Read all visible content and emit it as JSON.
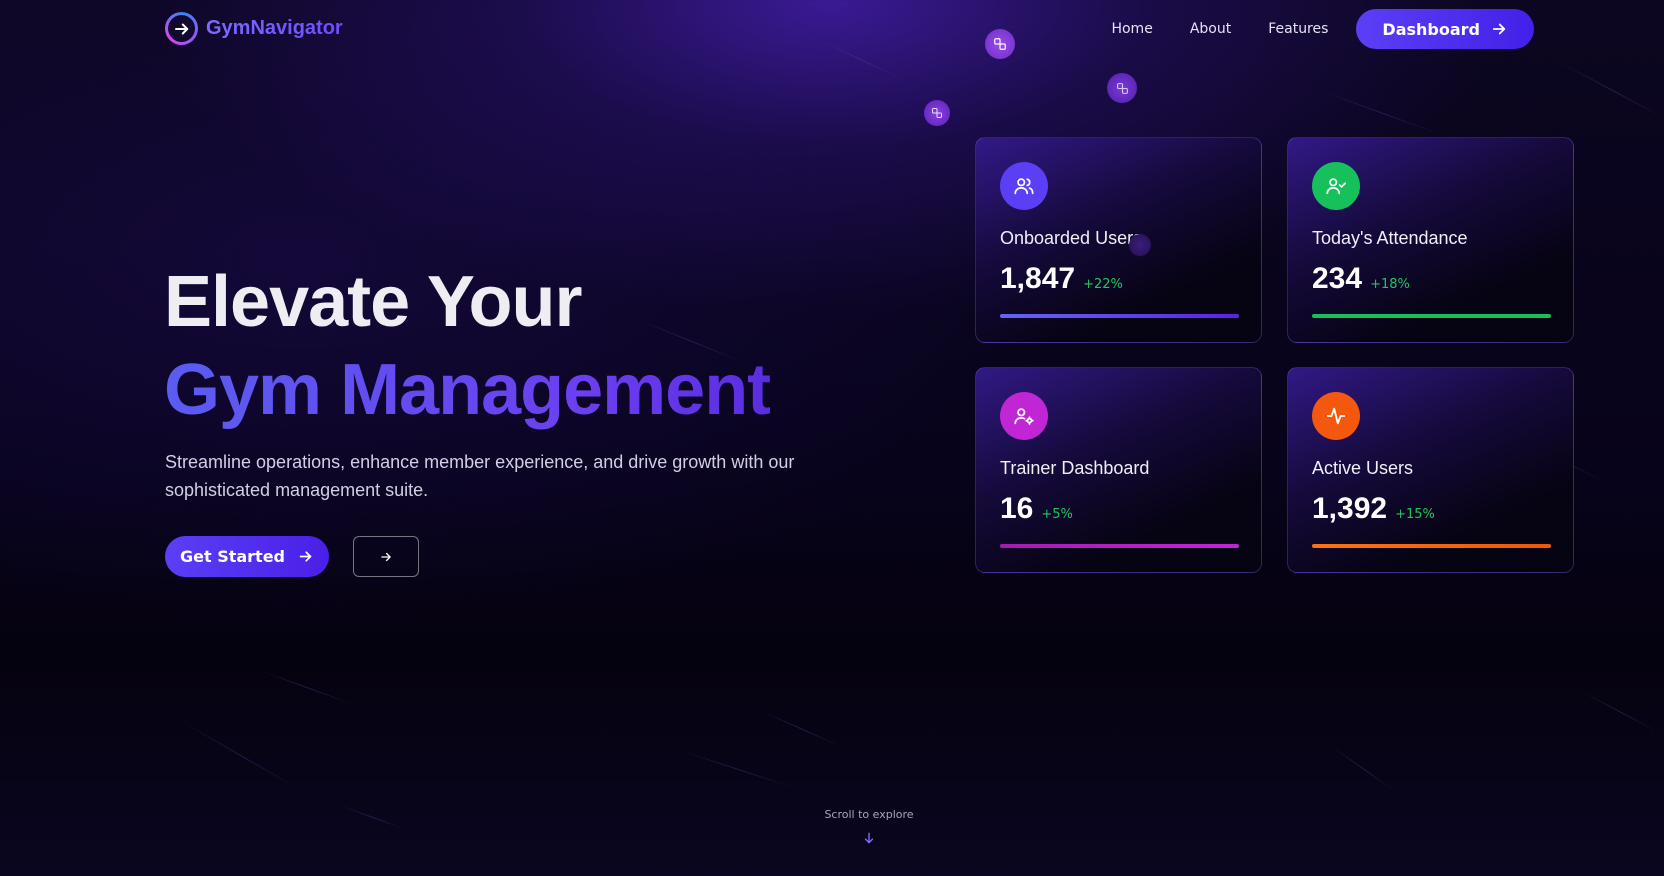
{
  "brand": {
    "name": "GymNavigator"
  },
  "nav": {
    "links": [
      "Home",
      "About",
      "Features"
    ],
    "cta_label": "Dashboard"
  },
  "hero": {
    "title_line1": "Elevate Your",
    "title_line2": "Gym Management",
    "subtitle": "Streamline operations, enhance member experience, and drive growth with our sophisticated management suite.",
    "primary_button": "Get Started"
  },
  "stats": [
    {
      "label": "Onboarded Users",
      "value": "1,847",
      "change": "+22%",
      "icon": "users-icon",
      "color": "#5b3ff5",
      "bar_color": "#5b3ff5"
    },
    {
      "label": "Today's Attendance",
      "value": "234",
      "change": "+18%",
      "icon": "user-check-icon",
      "color": "#16c05a",
      "bar_color": "#16c05a"
    },
    {
      "label": "Trainer Dashboard",
      "value": "16",
      "change": "+5%",
      "icon": "user-cog-icon",
      "color": "#c026d3",
      "bar_color": "#b41fe0"
    },
    {
      "label": "Active Users",
      "value": "1,392",
      "change": "+15%",
      "icon": "activity-icon",
      "color": "#f4580f",
      "bar_color": "#f0620e"
    }
  ],
  "scroll_hint": "Scroll to explore"
}
